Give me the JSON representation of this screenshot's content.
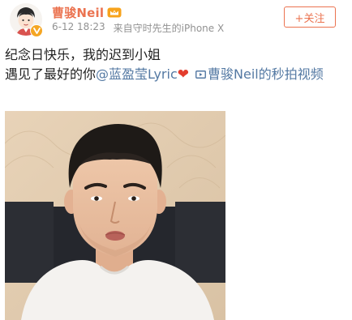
{
  "post": {
    "author": {
      "name": "曹骏Neil",
      "avatar_icon": "cartoon-avatar-icon",
      "verified_badge_icon": "verified-v-badge-icon",
      "member_icon": "weibo-vip-crown-icon"
    },
    "timestamp": "6-12 18:23",
    "source": "来自守时先生的iPhone X",
    "follow_button_label": "+关注",
    "text": {
      "line1": "纪念日快乐，我的迟到小姐",
      "line2_prefix": "遇见了最好的你",
      "mention": "@蓝盈莹Lyric",
      "heart": "❤",
      "video_link_label": "曹骏Neil的秒拍视频",
      "video_link_icon": "video-link-icon"
    },
    "video": {
      "thumbnail_icon": "video-thumbnail-man-in-white-tshirt"
    }
  },
  "colors": {
    "accent": "#eb7350",
    "link": "#5479a3",
    "meta_gray": "#929292",
    "text": "#222222",
    "heart": "#e33c2d"
  }
}
